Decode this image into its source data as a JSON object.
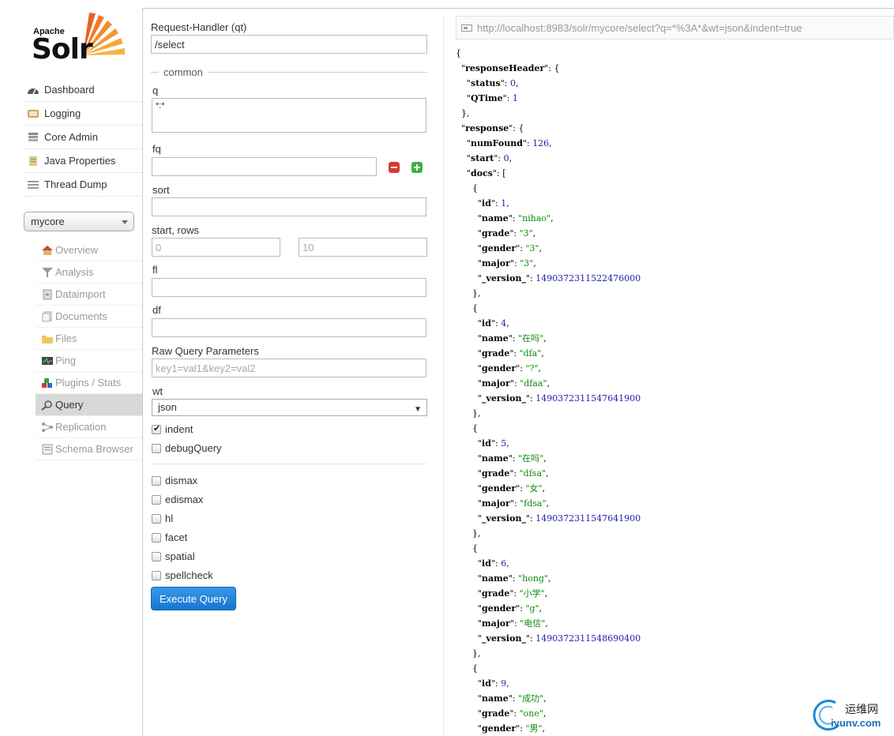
{
  "logo": {
    "apache": "Apache",
    "solr": "Solr"
  },
  "main_nav": [
    {
      "label": "Dashboard",
      "icon": "dashboard-icon"
    },
    {
      "label": "Logging",
      "icon": "logging-icon"
    },
    {
      "label": "Core Admin",
      "icon": "core-admin-icon"
    },
    {
      "label": "Java Properties",
      "icon": "java-properties-icon"
    },
    {
      "label": "Thread Dump",
      "icon": "thread-dump-icon"
    }
  ],
  "core_selector": {
    "value": "mycore"
  },
  "core_nav": [
    {
      "label": "Overview",
      "icon": "house-icon"
    },
    {
      "label": "Analysis",
      "icon": "funnel-icon"
    },
    {
      "label": "Dataimport",
      "icon": "dataimport-icon"
    },
    {
      "label": "Documents",
      "icon": "documents-icon"
    },
    {
      "label": "Files",
      "icon": "folder-icon"
    },
    {
      "label": "Ping",
      "icon": "ping-icon"
    },
    {
      "label": "Plugins / Stats",
      "icon": "plugins-icon"
    },
    {
      "label": "Query",
      "icon": "magnifier-icon"
    },
    {
      "label": "Replication",
      "icon": "replication-icon"
    },
    {
      "label": "Schema Browser",
      "icon": "schema-icon"
    }
  ],
  "form": {
    "qt_label": "Request-Handler (qt)",
    "qt_value": "/select",
    "common_legend": "common",
    "q_label": "q",
    "q_value": "*:*",
    "fq_label": "fq",
    "sort_label": "sort",
    "start_rows_label": "start, rows",
    "start_placeholder": "0",
    "rows_placeholder": "10",
    "fl_label": "fl",
    "df_label": "df",
    "raw_label": "Raw Query Parameters",
    "raw_placeholder": "key1=val1&key2=val2",
    "wt_label": "wt",
    "wt_value": "json",
    "indent_label": "indent",
    "debug_label": "debugQuery",
    "dismax_label": "dismax",
    "edismax_label": "edismax",
    "hl_label": "hl",
    "facet_label": "facet",
    "spatial_label": "spatial",
    "spellcheck_label": "spellcheck",
    "execute_label": "Execute Query"
  },
  "response": {
    "url": "http://localhost:8983/solr/mycore/select?q=*%3A*&wt=json&indent=true",
    "json_lines": [
      {
        "t": [
          [
            "p",
            "{"
          ]
        ]
      },
      {
        "t": [
          [
            "p",
            "  \""
          ],
          [
            "k",
            "responseHeader"
          ],
          [
            "p",
            "\": {"
          ]
        ]
      },
      {
        "t": [
          [
            "p",
            "    \""
          ],
          [
            "k",
            "status"
          ],
          [
            "p",
            "\": "
          ],
          [
            "n",
            "0"
          ],
          [
            "p",
            ","
          ]
        ]
      },
      {
        "t": [
          [
            "p",
            "    \""
          ],
          [
            "k",
            "QTime"
          ],
          [
            "p",
            "\": "
          ],
          [
            "n",
            "1"
          ]
        ]
      },
      {
        "t": [
          [
            "p",
            "  },"
          ]
        ]
      },
      {
        "t": [
          [
            "p",
            "  \""
          ],
          [
            "k",
            "response"
          ],
          [
            "p",
            "\": {"
          ]
        ]
      },
      {
        "t": [
          [
            "p",
            "    \""
          ],
          [
            "k",
            "numFound"
          ],
          [
            "p",
            "\": "
          ],
          [
            "n",
            "126"
          ],
          [
            "p",
            ","
          ]
        ]
      },
      {
        "t": [
          [
            "p",
            "    \""
          ],
          [
            "k",
            "start"
          ],
          [
            "p",
            "\": "
          ],
          [
            "n",
            "0"
          ],
          [
            "p",
            ","
          ]
        ]
      },
      {
        "t": [
          [
            "p",
            "    \""
          ],
          [
            "k",
            "docs"
          ],
          [
            "p",
            "\": ["
          ]
        ]
      },
      {
        "t": [
          [
            "p",
            "      {"
          ]
        ]
      },
      {
        "t": [
          [
            "p",
            "        \""
          ],
          [
            "k",
            "id"
          ],
          [
            "p",
            "\": "
          ],
          [
            "n",
            "1"
          ],
          [
            "p",
            ","
          ]
        ]
      },
      {
        "t": [
          [
            "p",
            "        \""
          ],
          [
            "k",
            "name"
          ],
          [
            "p",
            "\": "
          ],
          [
            "s",
            "\"nihao\""
          ],
          [
            "p",
            ","
          ]
        ]
      },
      {
        "t": [
          [
            "p",
            "        \""
          ],
          [
            "k",
            "grade"
          ],
          [
            "p",
            "\": "
          ],
          [
            "s",
            "\"3\""
          ],
          [
            "p",
            ","
          ]
        ]
      },
      {
        "t": [
          [
            "p",
            "        \""
          ],
          [
            "k",
            "gender"
          ],
          [
            "p",
            "\": "
          ],
          [
            "s",
            "\"3\""
          ],
          [
            "p",
            ","
          ]
        ]
      },
      {
        "t": [
          [
            "p",
            "        \""
          ],
          [
            "k",
            "major"
          ],
          [
            "p",
            "\": "
          ],
          [
            "s",
            "\"3\""
          ],
          [
            "p",
            ","
          ]
        ]
      },
      {
        "t": [
          [
            "p",
            "        \""
          ],
          [
            "k",
            "_version_"
          ],
          [
            "p",
            "\": "
          ],
          [
            "n",
            "1490372311522476000"
          ]
        ]
      },
      {
        "t": [
          [
            "p",
            "      },"
          ]
        ]
      },
      {
        "t": [
          [
            "p",
            "      {"
          ]
        ]
      },
      {
        "t": [
          [
            "p",
            "        \""
          ],
          [
            "k",
            "id"
          ],
          [
            "p",
            "\": "
          ],
          [
            "n",
            "4"
          ],
          [
            "p",
            ","
          ]
        ]
      },
      {
        "t": [
          [
            "p",
            "        \""
          ],
          [
            "k",
            "name"
          ],
          [
            "p",
            "\": "
          ],
          [
            "s",
            "\"在吗\""
          ],
          [
            "p",
            ","
          ]
        ]
      },
      {
        "t": [
          [
            "p",
            "        \""
          ],
          [
            "k",
            "grade"
          ],
          [
            "p",
            "\": "
          ],
          [
            "s",
            "\"dfa\""
          ],
          [
            "p",
            ","
          ]
        ]
      },
      {
        "t": [
          [
            "p",
            "        \""
          ],
          [
            "k",
            "gender"
          ],
          [
            "p",
            "\": "
          ],
          [
            "s",
            "\"?\""
          ],
          [
            "p",
            ","
          ]
        ]
      },
      {
        "t": [
          [
            "p",
            "        \""
          ],
          [
            "k",
            "major"
          ],
          [
            "p",
            "\": "
          ],
          [
            "s",
            "\"dfaa\""
          ],
          [
            "p",
            ","
          ]
        ]
      },
      {
        "t": [
          [
            "p",
            "        \""
          ],
          [
            "k",
            "_version_"
          ],
          [
            "p",
            "\": "
          ],
          [
            "n",
            "1490372311547641900"
          ]
        ]
      },
      {
        "t": [
          [
            "p",
            "      },"
          ]
        ]
      },
      {
        "t": [
          [
            "p",
            "      {"
          ]
        ]
      },
      {
        "t": [
          [
            "p",
            "        \""
          ],
          [
            "k",
            "id"
          ],
          [
            "p",
            "\": "
          ],
          [
            "n",
            "5"
          ],
          [
            "p",
            ","
          ]
        ]
      },
      {
        "t": [
          [
            "p",
            "        \""
          ],
          [
            "k",
            "name"
          ],
          [
            "p",
            "\": "
          ],
          [
            "s",
            "\"在吗\""
          ],
          [
            "p",
            ","
          ]
        ]
      },
      {
        "t": [
          [
            "p",
            "        \""
          ],
          [
            "k",
            "grade"
          ],
          [
            "p",
            "\": "
          ],
          [
            "s",
            "\"dfsa\""
          ],
          [
            "p",
            ","
          ]
        ]
      },
      {
        "t": [
          [
            "p",
            "        \""
          ],
          [
            "k",
            "gender"
          ],
          [
            "p",
            "\": "
          ],
          [
            "s",
            "\"女\""
          ],
          [
            "p",
            ","
          ]
        ]
      },
      {
        "t": [
          [
            "p",
            "        \""
          ],
          [
            "k",
            "major"
          ],
          [
            "p",
            "\": "
          ],
          [
            "s",
            "\"fdsa\""
          ],
          [
            "p",
            ","
          ]
        ]
      },
      {
        "t": [
          [
            "p",
            "        \""
          ],
          [
            "k",
            "_version_"
          ],
          [
            "p",
            "\": "
          ],
          [
            "n",
            "1490372311547641900"
          ]
        ]
      },
      {
        "t": [
          [
            "p",
            "      },"
          ]
        ]
      },
      {
        "t": [
          [
            "p",
            "      {"
          ]
        ]
      },
      {
        "t": [
          [
            "p",
            "        \""
          ],
          [
            "k",
            "id"
          ],
          [
            "p",
            "\": "
          ],
          [
            "n",
            "6"
          ],
          [
            "p",
            ","
          ]
        ]
      },
      {
        "t": [
          [
            "p",
            "        \""
          ],
          [
            "k",
            "name"
          ],
          [
            "p",
            "\": "
          ],
          [
            "s",
            "\"hong\""
          ],
          [
            "p",
            ","
          ]
        ]
      },
      {
        "t": [
          [
            "p",
            "        \""
          ],
          [
            "k",
            "grade"
          ],
          [
            "p",
            "\": "
          ],
          [
            "s",
            "\"小学\""
          ],
          [
            "p",
            ","
          ]
        ]
      },
      {
        "t": [
          [
            "p",
            "        \""
          ],
          [
            "k",
            "gender"
          ],
          [
            "p",
            "\": "
          ],
          [
            "s",
            "\"g\""
          ],
          [
            "p",
            ","
          ]
        ]
      },
      {
        "t": [
          [
            "p",
            "        \""
          ],
          [
            "k",
            "major"
          ],
          [
            "p",
            "\": "
          ],
          [
            "s",
            "\"电信\""
          ],
          [
            "p",
            ","
          ]
        ]
      },
      {
        "t": [
          [
            "p",
            "        \""
          ],
          [
            "k",
            "_version_"
          ],
          [
            "p",
            "\": "
          ],
          [
            "n",
            "1490372311548690400"
          ]
        ]
      },
      {
        "t": [
          [
            "p",
            "      },"
          ]
        ]
      },
      {
        "t": [
          [
            "p",
            "      {"
          ]
        ]
      },
      {
        "t": [
          [
            "p",
            "        \""
          ],
          [
            "k",
            "id"
          ],
          [
            "p",
            "\": "
          ],
          [
            "n",
            "9"
          ],
          [
            "p",
            ","
          ]
        ]
      },
      {
        "t": [
          [
            "p",
            "        \""
          ],
          [
            "k",
            "name"
          ],
          [
            "p",
            "\": "
          ],
          [
            "s",
            "\"成功\""
          ],
          [
            "p",
            ","
          ]
        ]
      },
      {
        "t": [
          [
            "p",
            "        \""
          ],
          [
            "k",
            "grade"
          ],
          [
            "p",
            "\": "
          ],
          [
            "s",
            "\"one\""
          ],
          [
            "p",
            ","
          ]
        ]
      },
      {
        "t": [
          [
            "p",
            "        \""
          ],
          [
            "k",
            "gender"
          ],
          [
            "p",
            "\": "
          ],
          [
            "s",
            "\"男\""
          ],
          [
            "p",
            ","
          ]
        ]
      }
    ]
  },
  "watermark": {
    "line1": "运维网",
    "line2": "iyunv.com"
  }
}
